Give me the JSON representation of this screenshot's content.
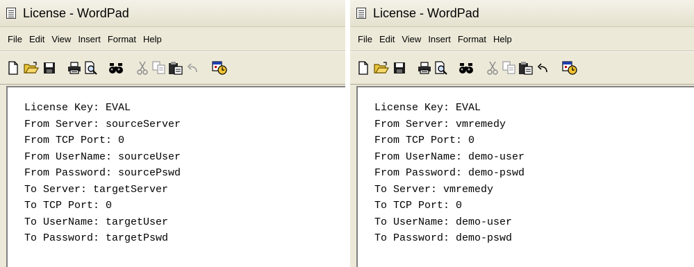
{
  "left_window": {
    "title": "License - WordPad",
    "menu": [
      "File",
      "Edit",
      "View",
      "Insert",
      "Format",
      "Help"
    ],
    "lines": [
      "License Key: EVAL",
      "From Server: sourceServer",
      "From TCP Port: 0",
      "From UserName: sourceUser",
      "From Password: sourcePswd",
      "To Server: targetServer",
      "To TCP Port: 0",
      "To UserName: targetUser",
      "To Password: targetPswd"
    ]
  },
  "right_window": {
    "title": "License - WordPad",
    "menu": [
      "File",
      "Edit",
      "View",
      "Insert",
      "Format",
      "Help"
    ],
    "lines": [
      "License Key: EVAL",
      "From Server: vmremedy",
      "From TCP Port: 0",
      "From UserName: demo-user",
      "From Password: demo-pswd",
      "To Server: vmremedy",
      "To TCP Port: 0",
      "To UserName: demo-user",
      "To Password: demo-pswd"
    ]
  },
  "toolbar_icons": [
    "new-icon",
    "open-icon",
    "save-icon",
    "print-icon",
    "print-preview-icon",
    "find-icon",
    "cut-icon",
    "copy-icon",
    "paste-icon",
    "undo-icon",
    "date-time-icon"
  ],
  "colors": {
    "chrome": "#ece9d8",
    "document": "#ffffff",
    "text": "#000000"
  }
}
